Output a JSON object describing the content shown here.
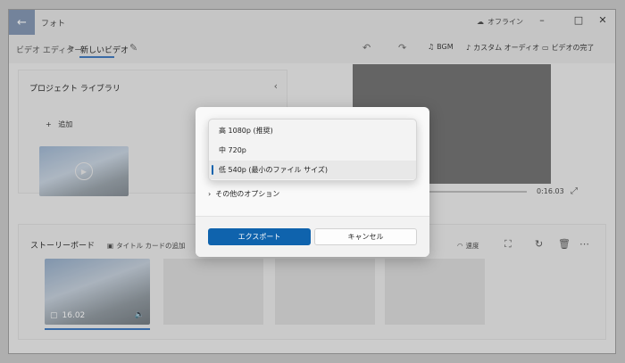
{
  "titlebar": {
    "title": "フォト",
    "offline": "オフライン",
    "back_icon": "arrow-left-icon",
    "minimize": "–",
    "maximize": "□",
    "close": "✕"
  },
  "toolbar": {
    "breadcrumb_parent": "ビデオ エディター",
    "breadcrumb_separator": ">",
    "breadcrumb_current": "新しいビデオ",
    "undo": "↶",
    "redo": "↷",
    "bgm": "BGM",
    "custom_audio": "カスタム オーディオ",
    "finish_video": "ビデオの完了"
  },
  "library": {
    "title": "プロジェクト ライブラリ",
    "add": "追加"
  },
  "preview": {
    "time": "0:16.03"
  },
  "storyboard": {
    "title": "ストーリーボード",
    "add_title_card": "タイトル カードの追加",
    "speed": "速度",
    "clip_duration": "16.02"
  },
  "dialog": {
    "more_options": "その他のオプション",
    "export_button": "エクスポート",
    "cancel_button": "キャンセル"
  },
  "quality_dropdown": {
    "options": [
      "高 1080p (推奨)",
      "中 720p",
      "低 540p (最小のファイル サイズ)"
    ],
    "selected_index": 2
  },
  "colors": {
    "accent": "#0f63ad",
    "title_accent": "#7f93b0"
  }
}
